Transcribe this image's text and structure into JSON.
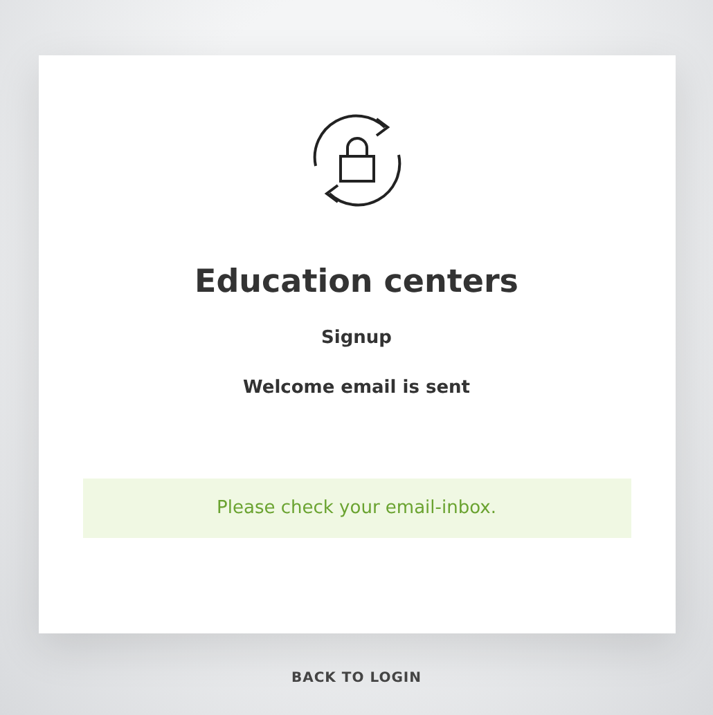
{
  "card": {
    "title": "Education centers",
    "subtitle": "Signup",
    "status": "Welcome email is sent",
    "message": "Please check your email-inbox."
  },
  "back_link": "BACK TO LOGIN"
}
